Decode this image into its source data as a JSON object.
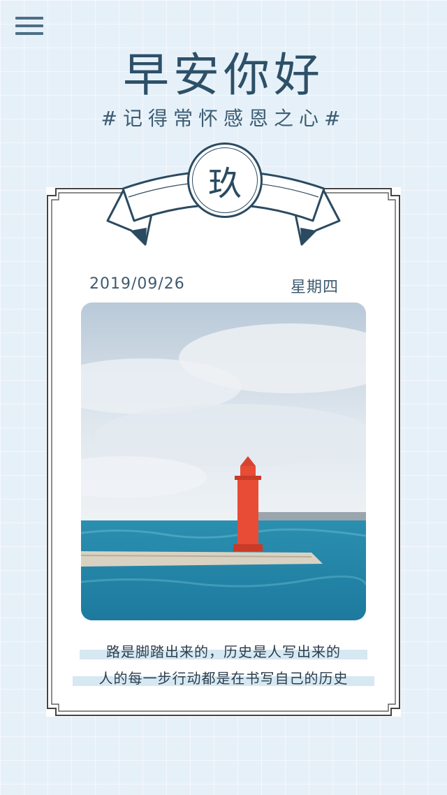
{
  "header": {
    "menu_icon": "hamburger-menu-icon",
    "title": "早安你好",
    "subtitle": "#记得常怀感恩之心#"
  },
  "card": {
    "seal_char": "玖",
    "date": "2019/09/26",
    "weekday": "星期四",
    "photo_icon": "lighthouse-photo",
    "quote_lines": [
      "路是脚踏出来的，历史是人写出来的",
      "人的每一步行动都是在书写自己的历史"
    ]
  },
  "colors": {
    "background": "#e6f0f8",
    "title": "#2d5068",
    "frame": "#3a3a3a",
    "seal": "#2b4a60",
    "highlight": "#d6e8f2"
  }
}
